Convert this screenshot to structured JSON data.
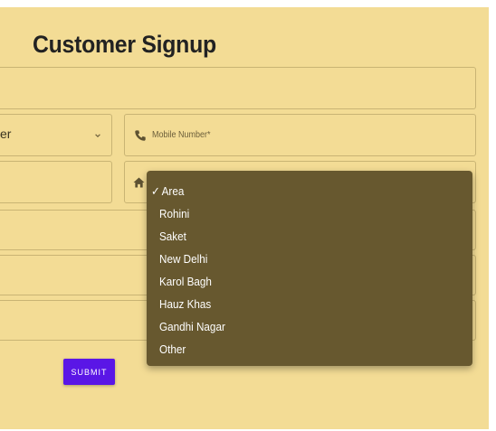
{
  "page": {
    "title": "Customer Signup"
  },
  "form": {
    "select_value_partial": "er",
    "mobile_placeholder": "Mobile Number*",
    "submit_label": "SUBMIT"
  },
  "area_dropdown": {
    "selected_mark": "✓",
    "options": [
      "Area",
      "Rohini",
      "Saket",
      "New Delhi",
      "Karol Bagh",
      "Hauz Khas",
      "Gandhi Nagar",
      "Other"
    ],
    "selected_index": 0
  },
  "icons": {
    "phone": "phone-icon",
    "home": "home-icon",
    "chevron": "chevron-down-icon"
  },
  "colors": {
    "background": "#f3dc95",
    "dropdown_bg": "#67582f",
    "submit_bg": "#5a16e6",
    "field_border": "#c9b474"
  }
}
